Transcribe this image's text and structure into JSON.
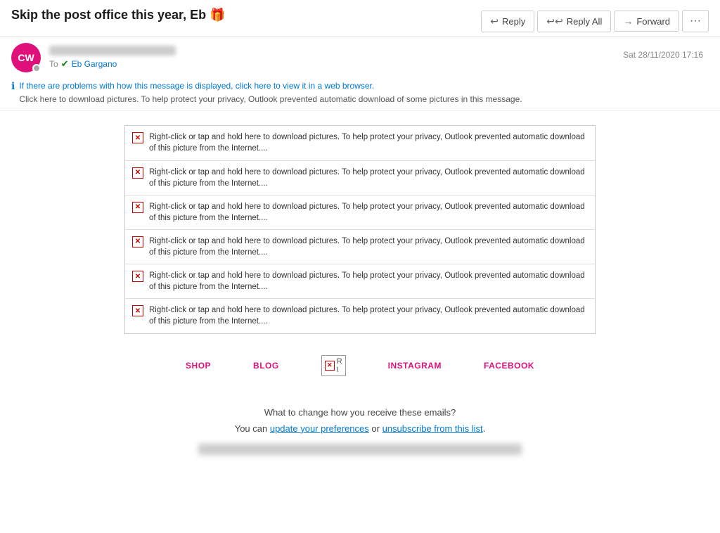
{
  "email": {
    "subject": "Skip the post office this year, Eb 🎁",
    "sender": {
      "initials": "CW",
      "avatar_bg": "#e0107b",
      "name_blurred": true,
      "email_blurred": true
    },
    "to_label": "To",
    "recipient": "Eb Gargano",
    "date": "Sat 28/11/2020 17:16"
  },
  "toolbar": {
    "reply_label": "Reply",
    "reply_all_label": "Reply All",
    "forward_label": "Forward",
    "more_label": "···"
  },
  "info_bar": {
    "line1": "If there are problems with how this message is displayed, click here to view it in a web browser.",
    "line2": "Click here to download pictures. To help protect your privacy, Outlook prevented automatic download of some pictures in this message."
  },
  "image_placeholder_text": "Right-click or tap and hold here to download pictures. To help protect your privacy, Outlook prevented automatic download of this picture from the Internet....",
  "image_placeholder_count": 6,
  "footer": {
    "links": [
      "SHOP",
      "BLOG",
      "INSTAGRAM",
      "FACEBOOK"
    ]
  },
  "bottom_section": {
    "text1": "What to change how you receive these emails?",
    "text2_before": "You can ",
    "text2_link1": "update your preferences",
    "text2_middle": " or ",
    "text2_link2": "unsubscribe from this list",
    "text2_after": "."
  }
}
